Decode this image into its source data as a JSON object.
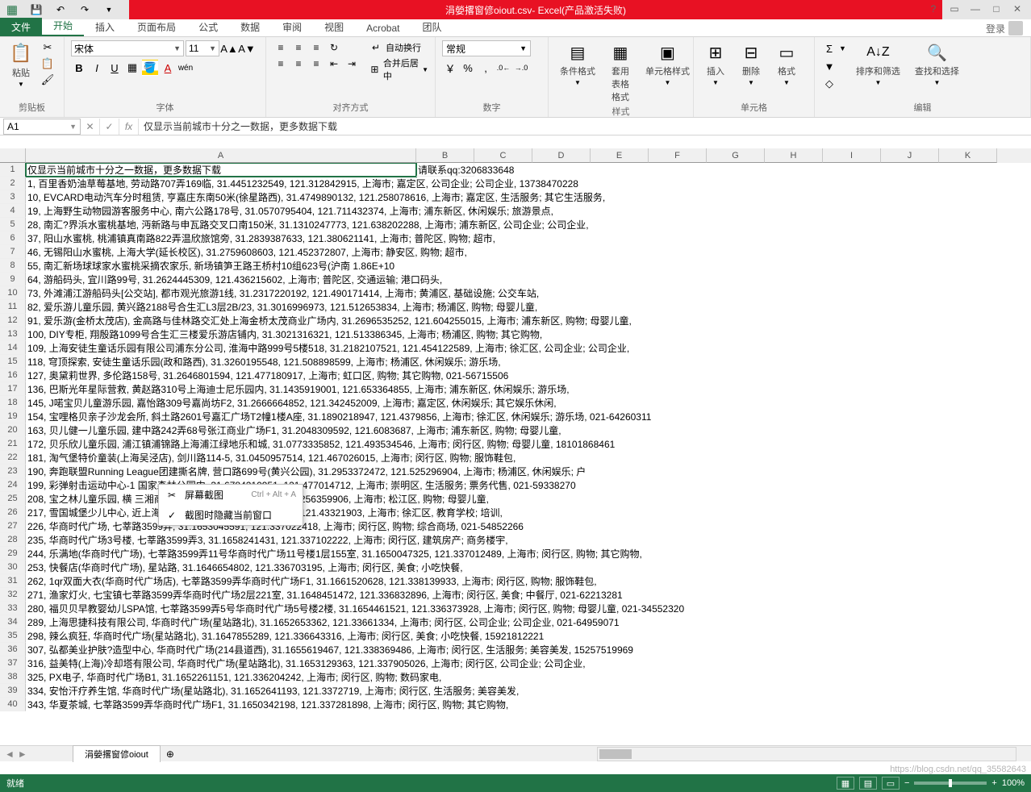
{
  "title_bar": {
    "filename": "涓嫈撂窗偐oiout.csv",
    "app": " -  Excel(产品激活失败)"
  },
  "window_controls": {
    "help": "?",
    "min": "—",
    "max": "□",
    "close": "✕"
  },
  "qat": {
    "save_icon": "💾",
    "undo_icon": "↶",
    "redo_icon": "↷"
  },
  "tabs": {
    "file": "文件",
    "list": [
      "开始",
      "插入",
      "页面布局",
      "公式",
      "数据",
      "审阅",
      "视图",
      "Acrobat",
      "团队"
    ],
    "active": 0,
    "login": "登录"
  },
  "ribbon": {
    "clipboard": {
      "paste": "粘贴",
      "label": "剪贴板",
      "cut_icon": "✂",
      "copy_icon": "📋",
      "painter_icon": "🖌"
    },
    "font": {
      "name": "宋体",
      "size": "11",
      "label": "字体",
      "b": "B",
      "i": "I",
      "u": "U",
      "border": "▦",
      "fill": "🪣",
      "color": "A",
      "grow": "A▲",
      "shrink": "A▼",
      "pinyin": "wén"
    },
    "align": {
      "label": "对齐方式",
      "wrap": "自动换行",
      "merge": "合并后居中"
    },
    "number": {
      "label": "数字",
      "format": "常规",
      "cur": "￥",
      "pct": "%",
      "comma": ",",
      "inc": ".0←",
      "dec": "→.0"
    },
    "styles": {
      "label": "样式",
      "cond": "条件格式",
      "tbl": "套用\n表格格式",
      "cell": "单元格样式"
    },
    "cells": {
      "label": "单元格",
      "ins": "插入",
      "del": "删除",
      "fmt": "格式"
    },
    "edit": {
      "label": "编辑",
      "sum": "Σ",
      "fill": "▼",
      "clear": "◇",
      "sort": "排序和筛选",
      "find": "查找和选择"
    }
  },
  "formula_bar": {
    "cell": "A1",
    "fx": "fx",
    "value": "仅显示当前城市十分之一数据，更多数据下载"
  },
  "columns": [
    "A",
    "B",
    "C",
    "D",
    "E",
    "F",
    "G",
    "H",
    "I",
    "J",
    "K"
  ],
  "col_a_width": 484,
  "other_col_width": 72,
  "row1": {
    "a": "仅显示当前城市十分之一数据，更多数据下载",
    "b_overflow": "请联系qq:3206833648"
  },
  "rows": [
    "1, 百里香奶油草莓基地, 劳动路707弄169临, 31.4451232549, 121.312842915, 上海市; 嘉定区, 公司企业; 公司企业, 13738470228",
    "10, EVCARD电动汽车分时租赁, 亨嘉庄东南50米(徐星路西), 31.4749890132, 121.258078616, 上海市; 嘉定区, 生活服务; 其它生活服务,",
    "19, 上海野生动物园游客服务中心, 南六公路178号, 31.0570795404, 121.711432374, 上海市; 浦东新区, 休闲娱乐; 旅游景点,",
    "28, 南汇?界浜水蜜桃基地, 沔新路与申瓦路交叉口南150米, 31.1310247773, 121.638202288, 上海市; 浦东新区, 公司企业; 公司企业,",
    "37, 阳山水蜜桃, 桃浦镇真南路822弄温欣旅馆旁, 31.2839387633, 121.380621141, 上海市; 普陀区, 购物; 超市,",
    "46, 无锡阳山水蜜桃, 上海大学(延长校区), 31.2759608603, 121.452372807, 上海市; 静安区, 购物; 超市,",
    "55, 南汇新场球球家水蜜桃采摘农家乐, 新场镇笋王路王桥村10组623号(沪南  1.86E+10",
    "64, 游船码头, 宜川路99号, 31.2624445309, 121.436215602, 上海市; 普陀区, 交通运输; 港口码头,",
    "73, 外滩浦江游船码头[公交站], 都市观光旅游1线, 31.2317220192, 121.490171414, 上海市; 黄浦区, 基础设施; 公交车站,",
    "82, 爱乐游儿童乐园, 黄兴路2188号合生汇L3层2B/23, 31.3016996973, 121.512653834, 上海市; 杨浦区, 购物; 母婴儿童,",
    "91, 爱乐游(金桥太茂店), 金高路与佳林路交汇处上海金桥太茂商业广场内, 31.2696535252, 121.604255015, 上海市; 浦东新区, 购物; 母婴儿童,",
    "100, DIY专柜, 翔殷路1099号合生汇三楼爱乐游店铺内, 31.3021316321, 121.513386345, 上海市; 杨浦区, 购物; 其它购物,",
    "109, 上海安徒生童话乐园有限公司浦东分公司, 淮海中路999号5楼518, 31.2182107521, 121.454122589, 上海市; 徐汇区, 公司企业; 公司企业,",
    "118, 穹顶探索, 安徒生童话乐园(政和路西), 31.3260195548, 121.508898599, 上海市; 杨浦区, 休闲娱乐; 游乐场,",
    "127, 奥黛莉世界, 多伦路158号, 31.2646801594, 121.477180917, 上海市; 虹口区, 购物; 其它购物, 021-56715506",
    "136, 巴斯光年星际营救, 黄赵路310号上海迪士尼乐园内, 31.1435919001, 121.653364855, 上海市; 浦东新区, 休闲娱乐; 游乐场,",
    "145, J喏宝贝儿童游乐园, 嘉怡路309号嘉尚坊F2, 31.2666664852, 121.342452009, 上海市; 嘉定区, 休闲娱乐; 其它娱乐休闲,",
    "154, 宝哩格贝亲子沙龙会所, 斜土路2601号嘉汇广场T2幢1楼A座, 31.1890218947, 121.4379856, 上海市; 徐汇区, 休闲娱乐; 游乐场, 021-64260311",
    "163, 贝儿健一儿童乐园, 建中路242弄68号张江商业广场F1, 31.2048309592, 121.6083687, 上海市; 浦东新区, 购物; 母婴儿童,",
    "172, 贝乐欣儿童乐园, 浦江镇浦锦路上海浦江绿地乐和城, 31.0773335852, 121.493534546, 上海市; 闵行区, 购物; 母婴儿童, 18101868461",
    "181, 淘气堡特价童装(上海吴泾店), 剑川路114-5, 31.0450957514, 121.467026015, 上海市; 闵行区, 购物; 服饰鞋包,",
    "190, 奔跑联盟Running                                               League团建撕名牌, 营口路699号(黄兴公园), 31.2953372472, 121.525296904, 上海市; 杨浦区, 休闲娱乐; 户",
    "199, 彩弹射击运动中心-1                                      国家森林公园内, 31.6784210951, 121.477014712, 上海市; 崇明区, 生活服务; 票务代售, 021-59338270",
    "208, 宝之林儿童乐园, 横                                       三湘商业广场F2, 31.1196174676, 121.256359906, 上海市; 松江区, 购物; 母婴儿童,",
    "217, 雪国城堡少儿中心,                                        近上海电子艺术中心), 31.1557410161, 121.43321903, 上海市; 徐汇区, 教育学校; 培训,",
    "226, 华商时代广场, 七莘路3599弄, 31.1653045591, 121.337022418, 上海市; 闵行区, 购物; 综合商场, 021-54852266",
    "235, 华商时代广场3号楼, 七莘路3599弄3, 31.1658241431, 121.337102222, 上海市; 闵行区, 建筑房产; 商务楼宇,",
    "244, 乐满地(华商时代广场), 七莘路3599弄11号华商时代广场11号楼1层155室, 31.1650047325, 121.337012489, 上海市; 闵行区, 购物; 其它购物,",
    "253, 快餐店(华商时代广场), 星站路, 31.1646654802, 121.336703195, 上海市; 闵行区, 美食; 小吃快餐,",
    "262, 1qr双面大衣(华商时代广场店), 七莘路3599弄华商时代广场F1, 31.1661520628, 121.338139933, 上海市; 闵行区, 购物; 服饰鞋包,",
    "271, 渔家灯火, 七宝镇七莘路3599弄华商时代广场2层221室, 31.1648451472, 121.336832896, 上海市; 闵行区, 美食; 中餐厅, 021-62213281",
    "280, 福贝贝早教婴幼儿SPA馆, 七莘路3599弄5号华商时代广场5号楼2楼, 31.1654461521, 121.336373928, 上海市; 闵行区, 购物; 母婴儿童, 021-34552320",
    "289, 上海思捷科技有限公司, 华商时代广场(星站路北), 31.1652653362, 121.33661334, 上海市; 闵行区, 公司企业; 公司企业, 021-64959071",
    "298, 辣么疯狂, 华商时代广场(星站路北), 31.1647855289, 121.336643316, 上海市; 闵行区, 美食; 小吃快餐, 15921812221",
    "307, 弘都美业护肤?造型中心, 华商时代广场(214县道西), 31.1655619467, 121.338369486, 上海市; 闵行区, 生活服务; 美容美发, 15257519969",
    "316, 益美特(上海)冷却塔有限公司, 华商时代广场(星站路北), 31.1653129363, 121.337905026, 上海市; 闵行区, 公司企业; 公司企业,",
    "325, PX电子, 华商时代广场B1, 31.1652261151, 121.336204242, 上海市; 闵行区, 购物; 数码家电,",
    "334, 安怡汗疗养生馆, 华商时代广场(星站路北), 31.1652641193, 121.3372719, 上海市; 闵行区, 生活服务; 美容美发,",
    "343, 华夏茶城, 七莘路3599弄华商时代广场F1, 31.1650342198, 121.337281898, 上海市; 闵行区, 购物; 其它购物,"
  ],
  "context_menu": {
    "item1": {
      "label": "屏幕截图",
      "shortcut": "Ctrl + Alt + A"
    },
    "item2": {
      "label": "截图时隐藏当前窗口",
      "checked": true
    }
  },
  "sheet": {
    "name": "涓嫈撂窗偐oiout",
    "add": "⊕"
  },
  "status_bar": {
    "ready": "就绪",
    "zoom": "100%",
    "plus": "+",
    "minus": "−"
  },
  "watermark": "https://blog.csdn.net/qq_35582643"
}
